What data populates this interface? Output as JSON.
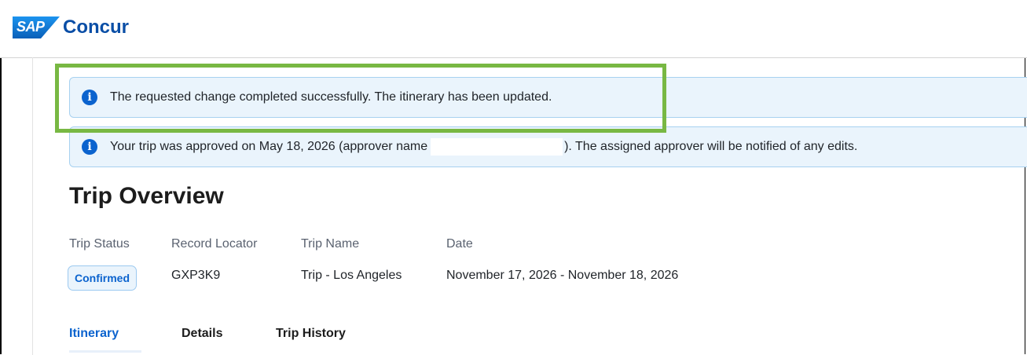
{
  "header": {
    "logo_mark": "SAP",
    "logo_text": "Concur"
  },
  "banners": [
    {
      "icon": "info-icon",
      "text": "The requested change completed successfully. The itinerary has been updated."
    },
    {
      "icon": "info-icon",
      "text_before": "Your trip was approved on May 18, 2026 (approver name",
      "text_after": "). The assigned approver will be notified of any edits."
    }
  ],
  "page": {
    "title": "Trip Overview"
  },
  "fields": {
    "status_label": "Trip Status",
    "status_value": "Confirmed",
    "record_label": "Record Locator",
    "record_value": "GXP3K9",
    "name_label": "Trip Name",
    "name_value": "Trip - Los Angeles",
    "date_label": "Date",
    "date_value": "November 17, 2026 - November 18, 2026"
  },
  "tabs": [
    {
      "label": "Itinerary",
      "active": true
    },
    {
      "label": "Details",
      "active": false
    },
    {
      "label": "Trip History",
      "active": false
    }
  ],
  "colors": {
    "accent": "#0b63ce",
    "brand": "#0a4ea6",
    "banner_bg": "#eaf4fc",
    "highlight": "#78b843"
  }
}
